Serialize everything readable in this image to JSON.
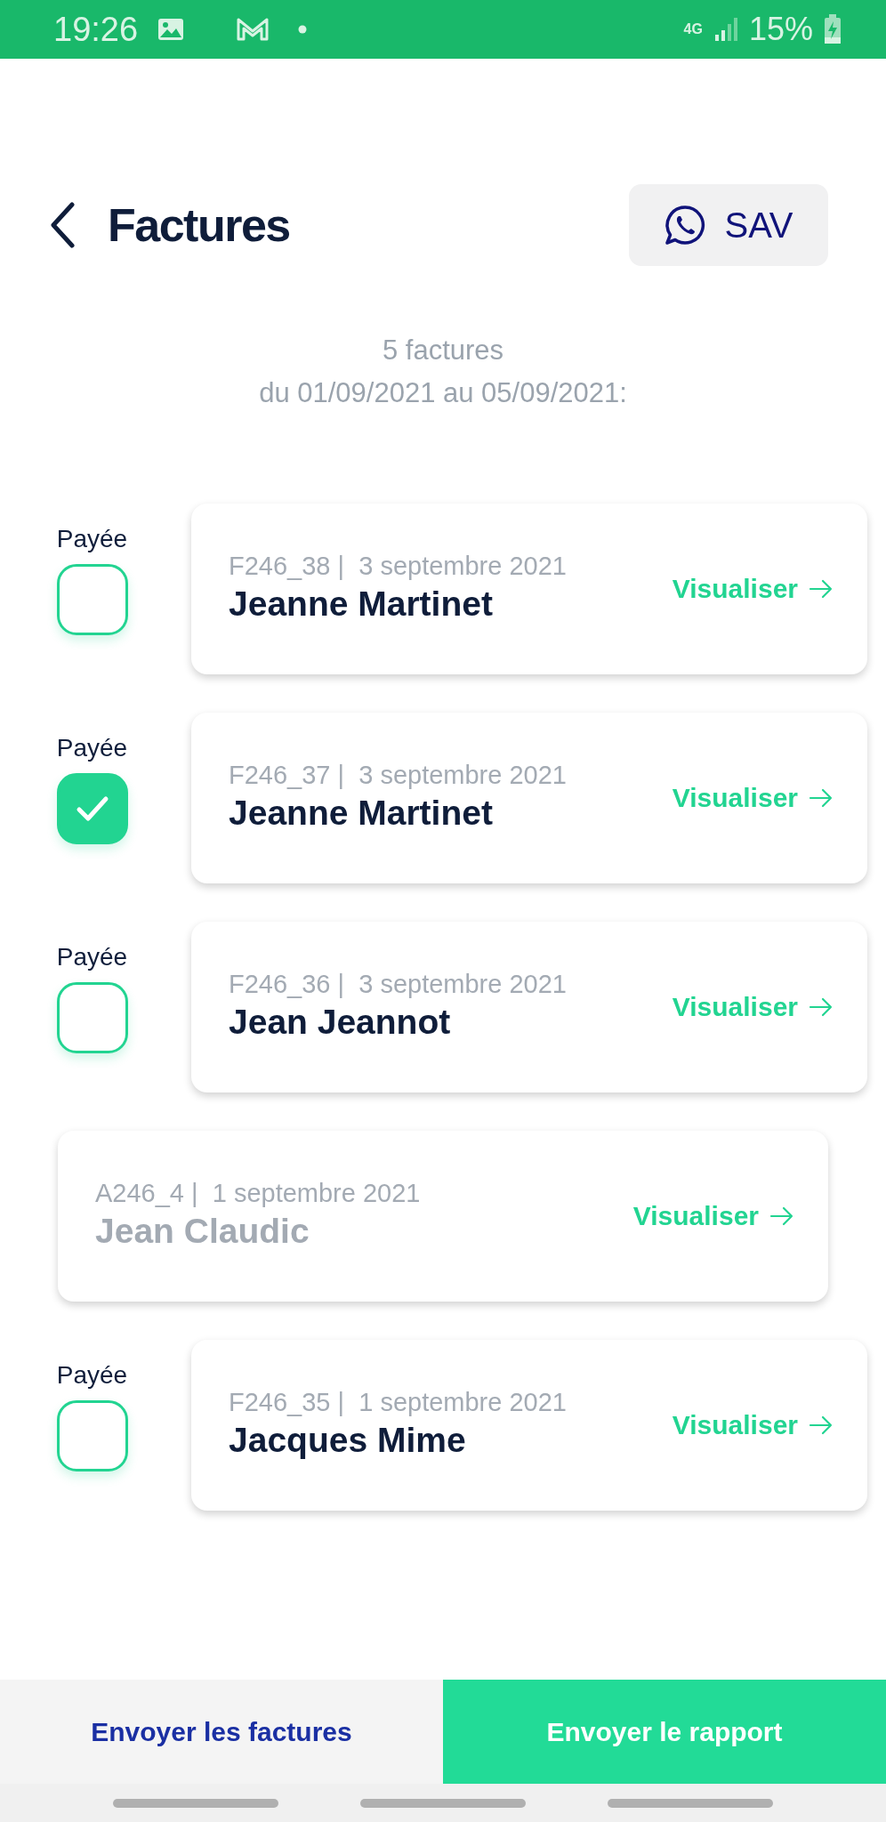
{
  "status_bar": {
    "time": "19:26",
    "network": "4G",
    "battery": "15%"
  },
  "header": {
    "title": "Factures",
    "support_button": "SAV"
  },
  "summary": {
    "count": "5 factures",
    "period": "du 01/09/2021 au 05/09/2021:"
  },
  "invoices": [
    {
      "kind": "invoice",
      "paid_label": "Payée",
      "paid": false,
      "meta": "F246_38 |  3 septembre 2021",
      "client": "Jeanne Martinet",
      "action": "Visualiser"
    },
    {
      "kind": "invoice",
      "paid_label": "Payée",
      "paid": true,
      "meta": "F246_37 |  3 septembre 2021",
      "client": "Jeanne Martinet",
      "action": "Visualiser"
    },
    {
      "kind": "invoice",
      "paid_label": "Payée",
      "paid": false,
      "meta": "F246_36 |  3 septembre 2021",
      "client": "Jean Jeannot",
      "action": "Visualiser"
    },
    {
      "kind": "credit",
      "meta": "A246_4 |  1 septembre 2021",
      "client": "Jean Claudic",
      "action": "Visualiser"
    },
    {
      "kind": "invoice",
      "paid_label": "Payée",
      "paid": false,
      "meta": "F246_35 |  1 septembre 2021",
      "client": "Jacques Mime",
      "action": "Visualiser"
    }
  ],
  "footer": {
    "buttons": [
      {
        "label": "Envoyer les factures",
        "kind": "secondary"
      },
      {
        "label": "Envoyer le rapport",
        "kind": "primary"
      }
    ]
  }
}
